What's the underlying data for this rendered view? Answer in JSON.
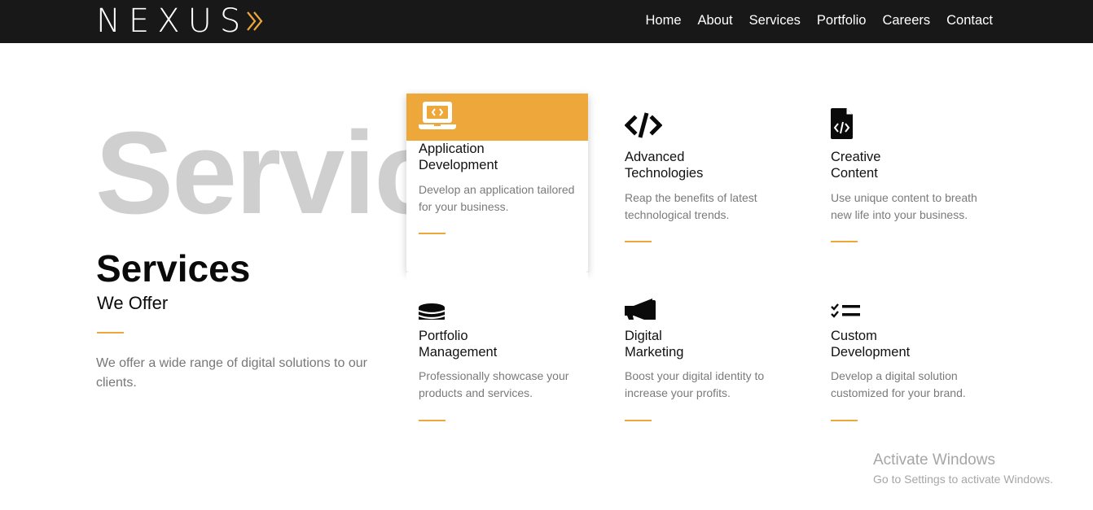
{
  "brand": {
    "name": "NEXUS",
    "accent_color": "#eda73a",
    "icon": "double-chevron-right-icon"
  },
  "nav": {
    "items": [
      {
        "label": "Home"
      },
      {
        "label": "About"
      },
      {
        "label": "Services"
      },
      {
        "label": "Portfolio"
      },
      {
        "label": "Careers"
      },
      {
        "label": "Contact"
      }
    ]
  },
  "intro": {
    "background_word": "Services",
    "title": "Services",
    "subtitle": "We Offer",
    "text": "We offer a wide range of digital solutions to our clients."
  },
  "services": [
    {
      "icon": "laptop-code-icon",
      "title_line1": "Application",
      "title_line2": "Development",
      "description": "Develop an application tailored for your business.",
      "highlighted": true
    },
    {
      "icon": "code-icon",
      "title_line1": "Advanced",
      "title_line2": "Technologies",
      "description": "Reap the benefits of latest technological trends.",
      "highlighted": false
    },
    {
      "icon": "file-code-icon",
      "title_line1": "Creative",
      "title_line2": "Content",
      "description": "Use unique content to breath new life into your business.",
      "highlighted": false
    },
    {
      "icon": "database-icon",
      "title_line1": "Portfolio",
      "title_line2": "Management",
      "description": "Professionally showcase your products and services.",
      "highlighted": false
    },
    {
      "icon": "megaphone-icon",
      "title_line1": "Digital",
      "title_line2": "Marketing",
      "description": "Boost your digital identity to increase your profits.",
      "highlighted": false
    },
    {
      "icon": "checklist-icon",
      "title_line1": "Custom",
      "title_line2": "Development",
      "description": "Develop a digital solution customized for your brand.",
      "highlighted": false
    }
  ],
  "watermark": {
    "title": "Activate Windows",
    "subtitle": "Go to Settings to activate Windows."
  },
  "colors": {
    "navbar_bg": "#181818",
    "accent": "#eda73a",
    "background_word": "#cfcfcf",
    "body_text": "#777777"
  }
}
